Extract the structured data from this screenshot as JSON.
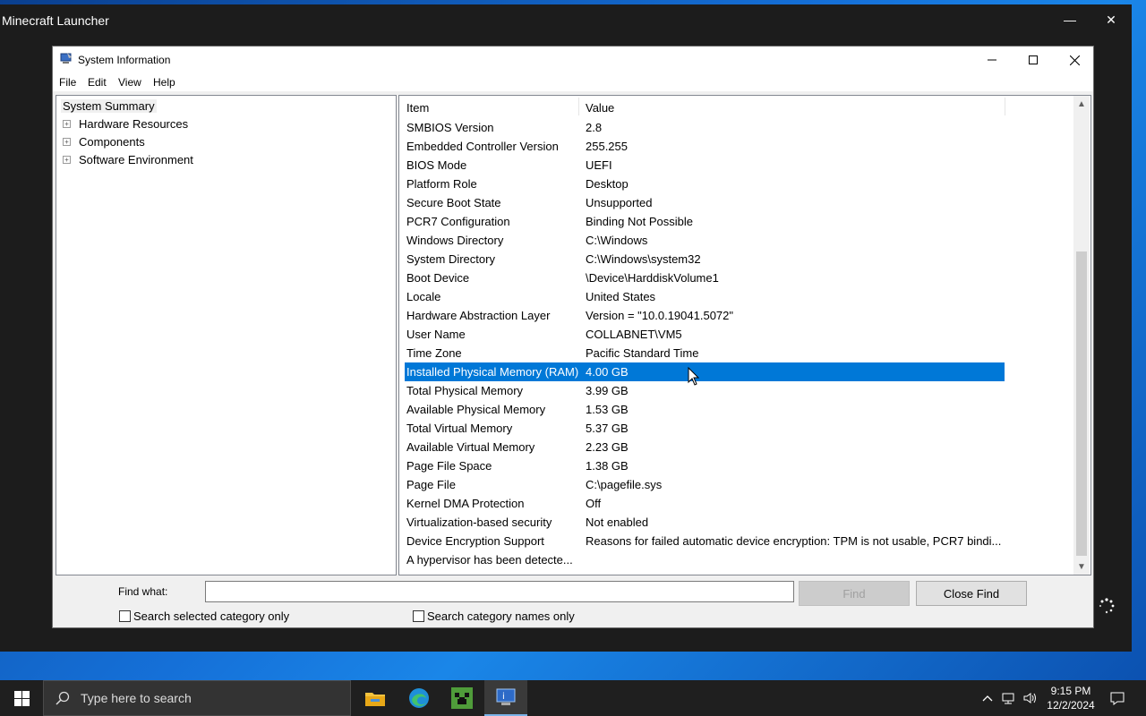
{
  "launcher": {
    "title": "Minecraft Launcher"
  },
  "window": {
    "title": "System Information",
    "menu": [
      "File",
      "Edit",
      "View",
      "Help"
    ]
  },
  "tree": {
    "root": "System Summary",
    "items": [
      "Hardware Resources",
      "Components",
      "Software Environment"
    ]
  },
  "list": {
    "columns": [
      "Item",
      "Value"
    ],
    "rows": [
      [
        "SMBIOS Version",
        "2.8"
      ],
      [
        "Embedded Controller Version",
        "255.255"
      ],
      [
        "BIOS Mode",
        "UEFI"
      ],
      [
        "Platform Role",
        "Desktop"
      ],
      [
        "Secure Boot State",
        "Unsupported"
      ],
      [
        "PCR7 Configuration",
        "Binding Not Possible"
      ],
      [
        "Windows Directory",
        "C:\\Windows"
      ],
      [
        "System Directory",
        "C:\\Windows\\system32"
      ],
      [
        "Boot Device",
        "\\Device\\HarddiskVolume1"
      ],
      [
        "Locale",
        "United States"
      ],
      [
        "Hardware Abstraction Layer",
        "Version = \"10.0.19041.5072\""
      ],
      [
        "User Name",
        "COLLABNET\\VM5"
      ],
      [
        "Time Zone",
        "Pacific Standard Time"
      ],
      [
        "Installed Physical Memory (RAM)",
        "4.00 GB"
      ],
      [
        "Total Physical Memory",
        "3.99 GB"
      ],
      [
        "Available Physical Memory",
        "1.53 GB"
      ],
      [
        "Total Virtual Memory",
        "5.37 GB"
      ],
      [
        "Available Virtual Memory",
        "2.23 GB"
      ],
      [
        "Page File Space",
        "1.38 GB"
      ],
      [
        "Page File",
        "C:\\pagefile.sys"
      ],
      [
        "Kernel DMA Protection",
        "Off"
      ],
      [
        "Virtualization-based security",
        "Not enabled"
      ],
      [
        "Device Encryption Support",
        "Reasons for failed automatic device encryption: TPM is not usable, PCR7 bindi..."
      ],
      [
        "A hypervisor has been detecte...",
        ""
      ]
    ],
    "selected_item": "Installed Physical Memory (RAM)"
  },
  "find": {
    "label": "Find what:",
    "value": "",
    "find_button": "Find",
    "close_button": "Close Find",
    "check_selected": "Search selected category only",
    "check_names": "Search category names only"
  },
  "taskbar": {
    "search_placeholder": "Type here to search",
    "time": "9:15 PM",
    "date": "12/2/2024"
  },
  "colors": {
    "selection": "#0078d7",
    "taskbar": "#1f1f1f"
  }
}
